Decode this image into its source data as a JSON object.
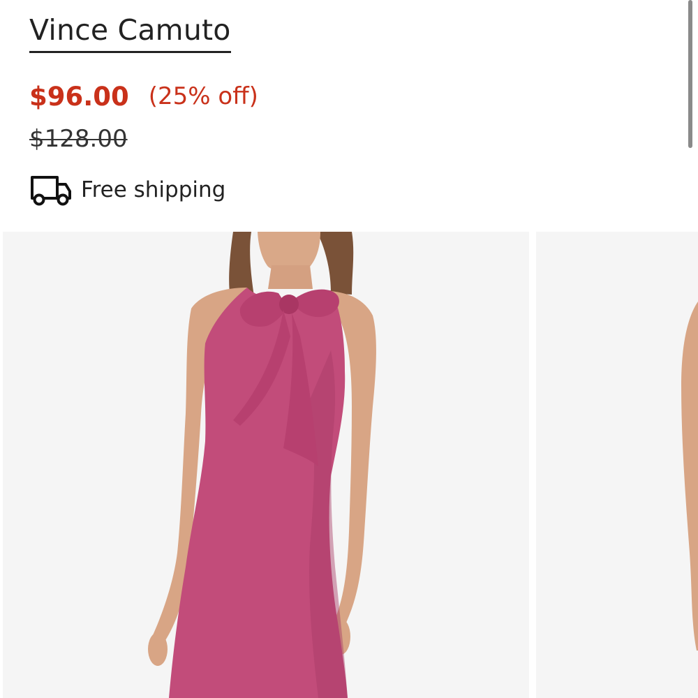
{
  "product": {
    "brand": "Vince Camuto",
    "sale_price": "$96.00",
    "discount": "(25% off)",
    "original_price": "$128.00",
    "shipping_text": "Free shipping",
    "shipping_icon": "truck-icon"
  },
  "colors": {
    "sale": "#c9311a",
    "dress": "#c24c7a",
    "background": "#f5f5f5"
  },
  "gallery": {
    "images": [
      {
        "label": "dress-front-view"
      },
      {
        "label": "dress-alternate-view"
      }
    ]
  }
}
